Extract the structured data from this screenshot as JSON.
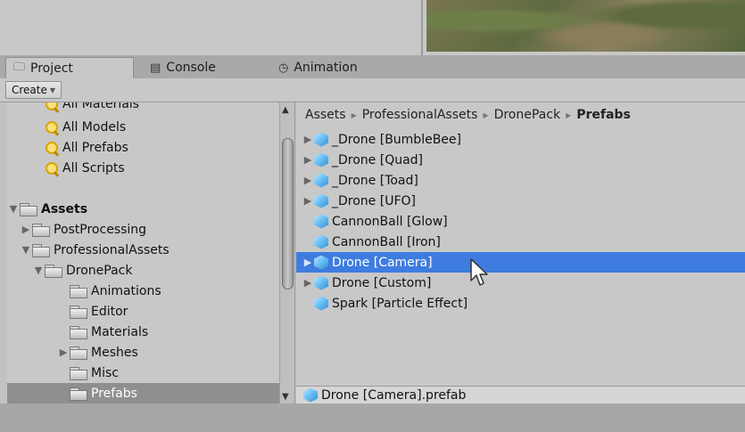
{
  "tabs": [
    {
      "label": "Project",
      "icon": "folder-icon"
    },
    {
      "label": "Console",
      "icon": "console-icon"
    },
    {
      "label": "Animation",
      "icon": "clock-icon"
    }
  ],
  "toolbar": {
    "create_label": "Create"
  },
  "left_tree": {
    "favorites": [
      {
        "label": "All Materials"
      },
      {
        "label": "All Models"
      },
      {
        "label": "All Prefabs"
      },
      {
        "label": "All Scripts"
      }
    ],
    "assets_label": "Assets",
    "folders": [
      {
        "label": "PostProcessing"
      },
      {
        "label": "ProfessionalAssets"
      },
      {
        "label": "DronePack"
      },
      {
        "label": "Animations"
      },
      {
        "label": "Editor"
      },
      {
        "label": "Materials"
      },
      {
        "label": "Meshes"
      },
      {
        "label": "Misc"
      },
      {
        "label": "Prefabs"
      }
    ]
  },
  "breadcrumb": {
    "items": [
      "Assets",
      "ProfessionalAssets",
      "DronePack"
    ],
    "current": "Prefabs"
  },
  "assets": [
    {
      "label": "_Drone [BumbleBee]",
      "expandable": true
    },
    {
      "label": "_Drone [Quad]",
      "expandable": true
    },
    {
      "label": "_Drone [Toad]",
      "expandable": true
    },
    {
      "label": "_Drone [UFO]",
      "expandable": true
    },
    {
      "label": "CannonBall [Glow]",
      "expandable": false
    },
    {
      "label": "CannonBall [Iron]",
      "expandable": false
    },
    {
      "label": "Drone [Camera]",
      "expandable": true,
      "selected": true
    },
    {
      "label": "Drone [Custom]",
      "expandable": true
    },
    {
      "label": "Spark [Particle Effect]",
      "expandable": false
    }
  ],
  "footer": {
    "selected_file": "Drone [Camera].prefab"
  },
  "colors": {
    "selection": "#3e7ce0",
    "panel": "#c8c8c8",
    "tree_selected": "#8f8f8f"
  }
}
